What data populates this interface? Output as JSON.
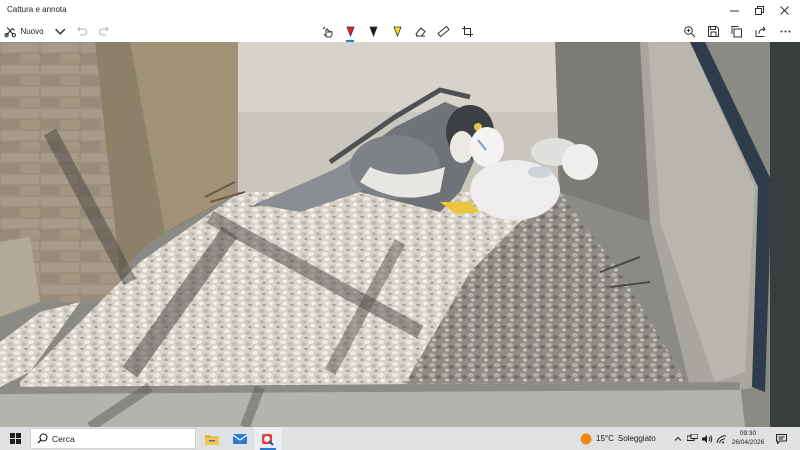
{
  "window": {
    "title": "Cattura e annota",
    "controls": [
      "minimize",
      "maximize",
      "close"
    ]
  },
  "toolbar": {
    "new_label": "Nuovo",
    "tools": [
      "touch-writing",
      "ballpoint-pen",
      "pencil",
      "highlighter",
      "eraser",
      "ruler",
      "crop"
    ],
    "actions": [
      "zoom",
      "save",
      "copy",
      "share",
      "more"
    ]
  },
  "canvas": {
    "content": "photo"
  },
  "taskbar": {
    "search_label": "Cerca",
    "apps": [
      "file-explorer",
      "mail",
      "snip-and-sketch"
    ],
    "weather": {
      "temp": "15°C",
      "condition": "Soleggiato"
    },
    "clock": {
      "time": "09:30",
      "date": "26/04/2026"
    }
  },
  "colors": {
    "accent": "#2b78d0",
    "taskbar": "#dfe1e3",
    "pen_red": "#e0242a",
    "highlighter_yellow": "#f7e51a"
  }
}
